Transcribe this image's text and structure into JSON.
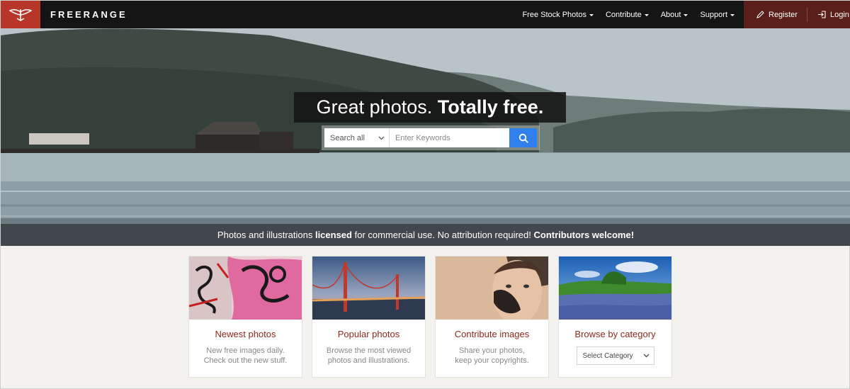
{
  "brand": {
    "name": "FREERANGE",
    "logo_color": "#b8352a"
  },
  "nav": {
    "items": [
      {
        "label": "Free Stock Photos"
      },
      {
        "label": "Contribute"
      },
      {
        "label": "About"
      },
      {
        "label": "Support"
      }
    ],
    "register_label": "Register",
    "login_label": "Login"
  },
  "hero": {
    "headline_light": "Great photos.",
    "headline_bold": "Totally free.",
    "search": {
      "category_value": "Search all",
      "placeholder": "Enter Keywords"
    },
    "tagline": {
      "part1": "Photos and illustrations ",
      "bold1": "licensed",
      "part2": " for commercial use. No attribution required! ",
      "bold2": "Contributors welcome!"
    }
  },
  "cards": [
    {
      "title": "Newest photos",
      "desc_line1": "New free images daily.",
      "desc_line2": "Check out the new stuff."
    },
    {
      "title": "Popular photos",
      "desc_line1": "Browse the most viewed",
      "desc_line2": "photos and illustrations."
    },
    {
      "title": "Contribute images",
      "desc_line1": "Share your photos,",
      "desc_line2": "keep your copyrights."
    },
    {
      "title": "Browse by category",
      "select_value": "Select Category"
    }
  ],
  "colors": {
    "accent": "#8c2a1e",
    "search_button": "#2f80ed",
    "nav_bg": "#141414",
    "auth_bg": "#5a1f1a"
  }
}
